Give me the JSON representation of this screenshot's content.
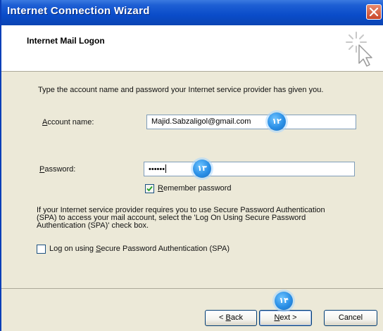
{
  "window": {
    "title": "Internet Connection Wizard"
  },
  "header": {
    "title": "Internet Mail Logon",
    "icon": "wizard-cursor-icon"
  },
  "content": {
    "intro": "Type the account name and password your Internet service provider has given you.",
    "account": {
      "label_hotkey": "A",
      "label_rest": "ccount name:",
      "value": "Majid.Sabzaligol@gmail.com"
    },
    "password": {
      "label_hotkey": "P",
      "label_rest": "assword:",
      "value": "••••••"
    },
    "remember": {
      "label_hotkey": "R",
      "label_rest": "emember password",
      "checked": true
    },
    "spa_note_lines": [
      "If your Internet service provider requires you to use Secure Password Authentication",
      "(SPA) to access your mail account, select the 'Log On Using Secure Password",
      "Authentication (SPA)' check box."
    ],
    "spa_checkbox": {
      "label_before": "Log on using ",
      "label_hotkey": "S",
      "label_rest": "ecure Password Authentication (SPA)",
      "checked": false
    }
  },
  "annotations": {
    "account_marker": "۱۲",
    "password_marker": "۱۳",
    "next_marker": "۱۴"
  },
  "buttons": {
    "back": {
      "prefix": "< ",
      "hotkey": "B",
      "rest": "ack"
    },
    "next": {
      "hotkey": "N",
      "rest": "ext >"
    },
    "cancel": "Cancel"
  },
  "colors": {
    "titlebar": "#0a4cc9",
    "dialog_background": "#ece9d8",
    "annotation_marker": "#2a8fe6"
  }
}
